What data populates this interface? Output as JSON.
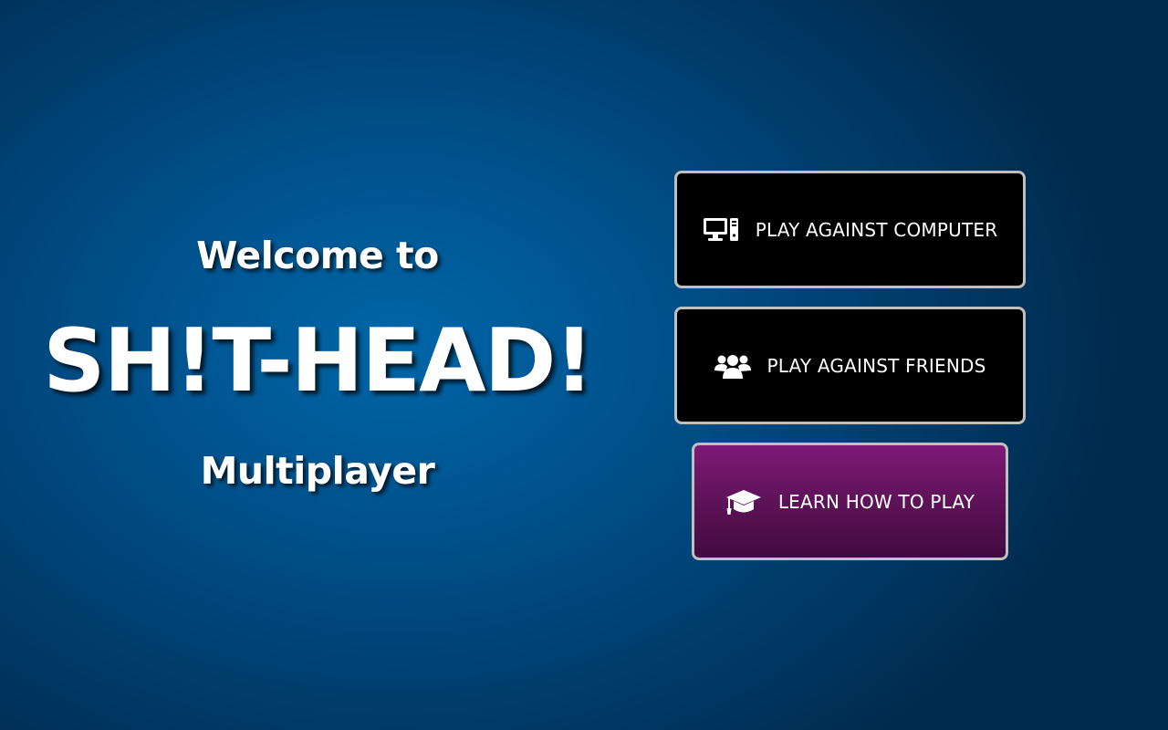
{
  "title": {
    "welcome": "Welcome to",
    "game_name": "SH!T-HEAD!",
    "subtitle": "Multiplayer"
  },
  "menu": {
    "buttons": [
      {
        "label": "PLAY AGAINST COMPUTER",
        "icon": "desktop-computer-icon"
      },
      {
        "label": "PLAY AGAINST FRIENDS",
        "icon": "users-group-icon"
      },
      {
        "label": "LEARN HOW TO PLAY",
        "icon": "graduation-cap-icon"
      }
    ]
  },
  "colors": {
    "background": "#0066a8",
    "button_dark": "#000000",
    "button_learn": "#6e1668",
    "button_border": "#bfbfbf",
    "text": "#ffffff"
  }
}
